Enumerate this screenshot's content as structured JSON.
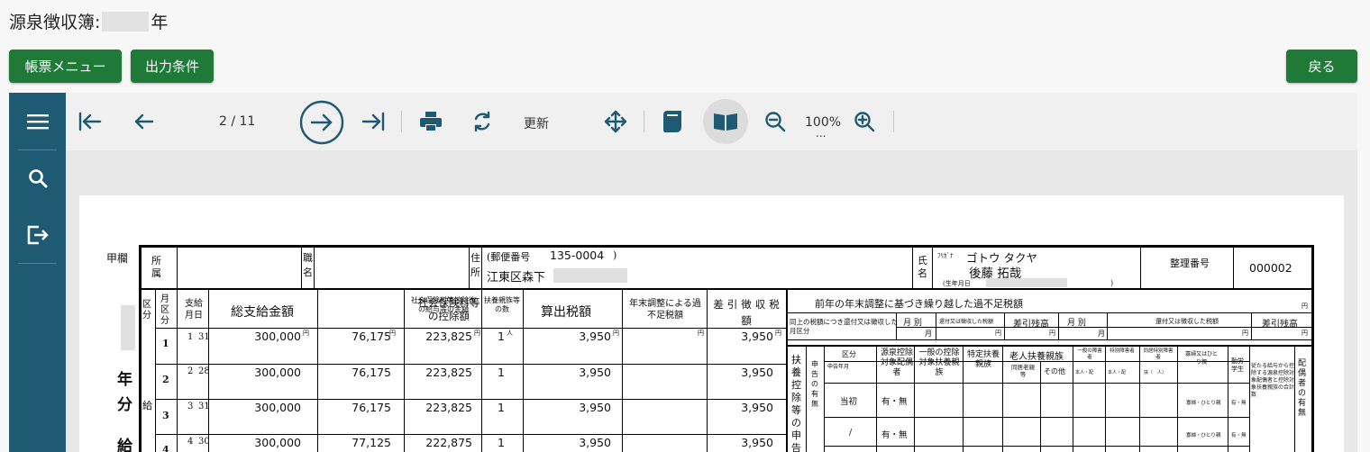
{
  "header": {
    "title_prefix": "源泉徴収簿:",
    "title_suffix": "年"
  },
  "buttons": {
    "report_menu": "帳票メニュー",
    "output_conditions": "出力条件",
    "back": "戻る"
  },
  "toolbar": {
    "page_indicator": "2 / 11",
    "refresh_label": "更新",
    "zoom_level": "100%",
    "zoom_more": "..."
  },
  "icons": [
    "menu-icon",
    "search-icon",
    "exit-icon",
    "first-page-icon",
    "prev-page-icon",
    "next-page-icon",
    "last-page-icon",
    "print-icon",
    "refresh-icon",
    "move-icon",
    "single-page-icon",
    "book-icon",
    "zoom-out-icon",
    "zoom-in-icon"
  ],
  "colors": {
    "accent_green": "#1f7a38",
    "sidebar_blue": "#1f5a73",
    "icon_blue": "#1f5a73"
  },
  "document": {
    "kou_otsu": "甲欄",
    "affiliation_label": "所属",
    "job_label": "職名",
    "address_label": "住所",
    "postal_prefix": "(郵便番号",
    "postal_code": "135-0004",
    "postal_suffix": ")",
    "address_value": "江東区森下",
    "name_label": "氏名",
    "furigana_label": "ﾌﾘｶﾞﾅ",
    "furigana_value": "ゴトウ タクヤ",
    "name_value": "後藤 拓哉",
    "birth_label": "(生年月日",
    "birth_suffix": ")",
    "ref_label": "整理番号",
    "ref_value": "000002",
    "side_chars": [
      "年",
      "分",
      "給"
    ],
    "kubun": "区分",
    "kyuyo": "給",
    "columns": {
      "month_kubun": "月区分",
      "pay_date": "支給月日",
      "total_pay": "総支給金額",
      "social_ins": "社会保険料等の控除額",
      "after_social": "社会保険料等控除後の給与等の金額",
      "dependents": "扶養親族等の数",
      "calc_tax": "算出税額",
      "year_end_short": "年末調整による過不足税額",
      "withholding": "差引徴収税額"
    },
    "yen": "円",
    "nin": "人",
    "rows": [
      {
        "no": "1",
        "month": "1",
        "day": "31",
        "total": "300,000",
        "social": "76,175",
        "after": "223,825",
        "deps": "1",
        "tax": "3,950",
        "diff": "",
        "withheld": "3,950"
      },
      {
        "no": "2",
        "month": "2",
        "day": "28",
        "total": "300,000",
        "social": "76,175",
        "after": "223,825",
        "deps": "1",
        "tax": "3,950",
        "diff": "",
        "withheld": "3,950"
      },
      {
        "no": "3",
        "month": "3",
        "day": "31",
        "total": "300,000",
        "social": "76,175",
        "after": "223,825",
        "deps": "1",
        "tax": "3,950",
        "diff": "",
        "withheld": "3,950"
      },
      {
        "no": "4",
        "month": "4",
        "day": "30",
        "total": "300,000",
        "social": "77,125",
        "after": "222,875",
        "deps": "1",
        "tax": "3,950",
        "diff": "",
        "withheld": "3,950"
      }
    ],
    "right": {
      "carryover_title": "前年の年末調整に基づき繰り越した過不足税額",
      "same_tax_label": "同上の税額につき還付又は徴収した月区分",
      "month_label": "月 別",
      "refund_label": "還付又は徴収した税額",
      "balance_label": "差引残高",
      "month_unit": "月",
      "dependent_deduction": "扶養控除等の申告",
      "declaration_presence": "申告の有無",
      "kubun_label": "区分",
      "shinkoku_month": "申告年月",
      "spouse_label": "源泉控除対象配偶者",
      "general_label": "一般の控除対象扶養親族",
      "specific_label": "特定扶養親族",
      "elderly_label": "老人扶養親族",
      "cohabit_label": "同居老親等",
      "other_label": "その他",
      "general_disabled": "一般の障害者",
      "special_disabled": "特別障害者",
      "cohabit_disabled": "同居特別障害者",
      "widow_label": "寡婦又はひとり親",
      "student_label": "勤労学生",
      "spouse_presence": "配偶者の有無",
      "deduction_note": "従たる給与から控除する源泉控除対象配偶者と控除対象扶養親族の合計数",
      "initial_label": "当初",
      "yes_no": "有・無",
      "slash": "/",
      "widow_small": "寡婦・ひとり親",
      "yes_no_small": "有・無",
      "principal_short": "本人・配",
      "family_short": "扶（　人）",
      "sono_ta": "その他"
    }
  }
}
